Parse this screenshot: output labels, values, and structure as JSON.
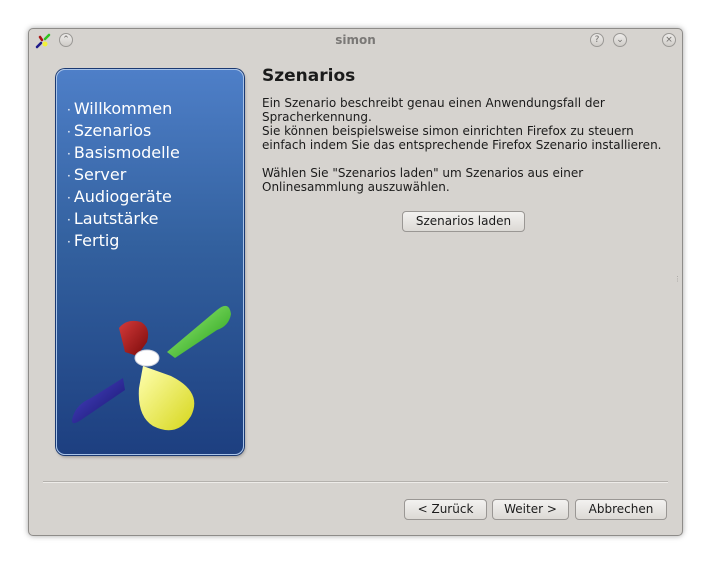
{
  "window": {
    "title": "simon",
    "controls": {
      "help": "?",
      "minimize": "⌄",
      "close": "×",
      "shade": "⌃"
    }
  },
  "wizard": {
    "steps": [
      {
        "label": "Willkommen"
      },
      {
        "label": "Szenarios"
      },
      {
        "label": "Basismodelle"
      },
      {
        "label": "Server"
      },
      {
        "label": "Audiogeräte"
      },
      {
        "label": "Lautstärke"
      },
      {
        "label": "Fertig"
      }
    ],
    "step_bullet": "·"
  },
  "page": {
    "heading": "Szenarios",
    "description": "Ein Szenario beschreibt genau einen Anwendungsfall der Spracherkennung.",
    "example": "Sie können beispielsweise simon einrichten Firefox zu steuern einfach indem Sie das entsprechende Firefox Szenario installieren.",
    "instruction": "Wählen Sie \"Szenarios laden\" um Szenarios aus einer Onlinesammlung auszuwählen.",
    "load_button": "Szenarios laden"
  },
  "buttons": {
    "back": "< Zurück",
    "next": "Weiter >",
    "cancel": "Abbrechen"
  },
  "colors": {
    "panel_top": "#4e7fc8",
    "panel_bottom": "#1d3f80",
    "logo_green": "#2fc31f",
    "logo_yellow": "#f1f13a",
    "logo_red": "#a81212",
    "logo_blue": "#1e1a8a"
  }
}
